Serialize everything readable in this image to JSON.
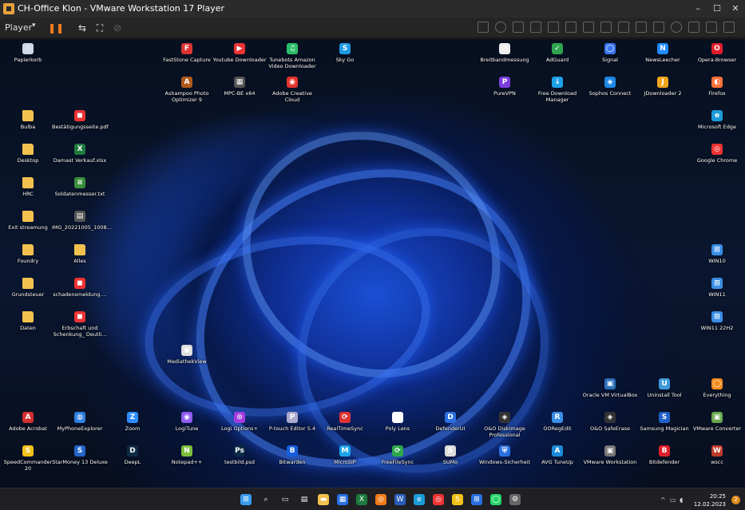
{
  "window": {
    "title": "CH-Office Klon - VMware Workstation 17 Player",
    "minimize": "–",
    "maximize": "☐",
    "close": "✕"
  },
  "toolbar": {
    "player": "Player",
    "caret": "▾",
    "pause": "❚❚",
    "send_keys": "⇆",
    "fullscreen": "⛶",
    "unity": "⊘"
  },
  "colors": {
    "accent": "#f07a1a",
    "folder": "#f2c14e"
  },
  "desktop_icons": [
    {
      "label": "Papierkorb",
      "color": "#cfd8e6",
      "glyph": "♲"
    },
    {
      "label": "FastStone Capture",
      "color": "#d33",
      "glyph": "F"
    },
    {
      "label": "Youtube Downloader",
      "color": "#e33",
      "glyph": "▶"
    },
    {
      "label": "Tunebots Amazon Video Downloader",
      "color": "#2cbf6a",
      "glyph": "♫"
    },
    {
      "label": "Sky Go",
      "color": "#1e9be3",
      "glyph": "S"
    },
    {
      "label": "Breitbandmessung",
      "color": "#eee",
      "glyph": "◔"
    },
    {
      "label": "AdGuard",
      "color": "#2ea44f",
      "glyph": "✓"
    },
    {
      "label": "Signal",
      "color": "#3a76f0",
      "glyph": "◯"
    },
    {
      "label": "NewsLeecher",
      "color": "#1f8bff",
      "glyph": "N"
    },
    {
      "label": "Opera-Browser",
      "color": "#e21e2b",
      "glyph": "O"
    },
    {
      "label": "Ashampoo Photo Optimizer 9",
      "color": "#b05a1a",
      "glyph": "A"
    },
    {
      "label": "MPC-BE x64",
      "color": "#555",
      "glyph": "▦"
    },
    {
      "label": "Adobe Creative Cloud",
      "color": "#e3342f",
      "glyph": "◉"
    },
    {
      "label": "PureVPN",
      "color": "#7a3ddc",
      "glyph": "P"
    },
    {
      "label": "Free Download Manager",
      "color": "#1ca2e8",
      "glyph": "↓"
    },
    {
      "label": "Sophos Connect",
      "color": "#1e88e5",
      "glyph": "◈"
    },
    {
      "label": "JDownloader 2",
      "color": "#f2a51a",
      "glyph": "J"
    },
    {
      "label": "Firefox",
      "color": "#ff7139",
      "glyph": "◐"
    },
    {
      "label": "Bulba",
      "color": "#f2c14e",
      "glyph": ""
    },
    {
      "label": "Bestätigungsseite.pdf",
      "color": "#e33",
      "glyph": "◼"
    },
    {
      "label": "Microsoft Edge",
      "color": "#1c9bd9",
      "glyph": "e"
    },
    {
      "label": "Desktop",
      "color": "#f2c14e",
      "glyph": ""
    },
    {
      "label": "Damast Verkauf.xlsx",
      "color": "#1d7a3e",
      "glyph": "X"
    },
    {
      "label": "Google Chrome",
      "color": "#e33",
      "glyph": "◎"
    },
    {
      "label": "HRC",
      "color": "#f2c14e",
      "glyph": ""
    },
    {
      "label": "Soldatenmesser.txt",
      "color": "#3b8e3b",
      "glyph": "≡"
    },
    {
      "label": "Exit streamung",
      "color": "#f2c14e",
      "glyph": ""
    },
    {
      "label": "IMG_20221005_1008...",
      "color": "#555",
      "glyph": "▤"
    },
    {
      "label": "Foundry",
      "color": "#f2c14e",
      "glyph": ""
    },
    {
      "label": "Alles",
      "color": "#f2c14e",
      "glyph": ""
    },
    {
      "label": "WIN10",
      "color": "#3a8ee6",
      "glyph": "⊞"
    },
    {
      "label": "Grundsteuer",
      "color": "#f2c14e",
      "glyph": ""
    },
    {
      "label": "schadensmeldung....",
      "color": "#e33",
      "glyph": "◼"
    },
    {
      "label": "WIN11",
      "color": "#3a8ee6",
      "glyph": "⊞"
    },
    {
      "label": "Daten",
      "color": "#f2c14e",
      "glyph": ""
    },
    {
      "label": "Erbschaft und Schenkung_ Deutli...",
      "color": "#e33",
      "glyph": "◼"
    },
    {
      "label": "WIN11 22H2",
      "color": "#3a8ee6",
      "glyph": "⊞"
    },
    {
      "label": "MediathekView",
      "color": "#ddd",
      "glyph": "▣"
    },
    {
      "label": "Oracle VM VirtualBox",
      "color": "#2b6fb7",
      "glyph": "▣"
    },
    {
      "label": "Uninstall Tool",
      "color": "#3a9ad9",
      "glyph": "U"
    },
    {
      "label": "Everything",
      "color": "#f28c1a",
      "glyph": "◯"
    },
    {
      "label": "Adobe Acrobat",
      "color": "#d32f2f",
      "glyph": "A"
    },
    {
      "label": "MyPhoneExplorer",
      "color": "#2f7fe0",
      "glyph": "◍"
    },
    {
      "label": "Zoom",
      "color": "#2d8cff",
      "glyph": "Z"
    },
    {
      "label": "LogiTune",
      "color": "#8e5cf0",
      "glyph": "◉"
    },
    {
      "label": "Logi Options+",
      "color": "#a33ce0",
      "glyph": "⊙"
    },
    {
      "label": "P-touch Editor 5.4",
      "color": "#aac",
      "glyph": "P"
    },
    {
      "label": "RealTimeSync",
      "color": "#d33",
      "glyph": "⟳"
    },
    {
      "label": "Poly Lens",
      "color": "#fff",
      "glyph": "◭"
    },
    {
      "label": "DefenderUI",
      "color": "#2a6fe0",
      "glyph": "D"
    },
    {
      "label": "O&O DiskImage Professional",
      "color": "#333",
      "glyph": "◈"
    },
    {
      "label": "OORegEdit",
      "color": "#3a8ee6",
      "glyph": "R"
    },
    {
      "label": "O&O SafeErase",
      "color": "#333",
      "glyph": "◈"
    },
    {
      "label": "Samsung Magician",
      "color": "#1e5fc8",
      "glyph": "S"
    },
    {
      "label": "VMware Converter",
      "color": "#6aa84f",
      "glyph": "▣"
    },
    {
      "label": "SpeedCommander 20",
      "color": "#f2c11a",
      "glyph": "S"
    },
    {
      "label": "StarMoney 13 Deluxe",
      "color": "#2466c8",
      "glyph": "S"
    },
    {
      "label": "DeepL",
      "color": "#0f2b46",
      "glyph": "D"
    },
    {
      "label": "Notepad++",
      "color": "#7bbf3a",
      "glyph": "N"
    },
    {
      "label": "testbild.psd",
      "color": "#0a2a44",
      "glyph": "Ps"
    },
    {
      "label": "Bitwarden",
      "color": "#175ddc",
      "glyph": "B"
    },
    {
      "label": "MicroSIP",
      "color": "#1aa3e8",
      "glyph": "M"
    },
    {
      "label": "FreeFileSync",
      "color": "#2ba84a",
      "glyph": "⟳"
    },
    {
      "label": "SUMo",
      "color": "#ddd",
      "glyph": "S"
    },
    {
      "label": "Windows-Sicherheit",
      "color": "#2a6fe0",
      "glyph": "⛨"
    },
    {
      "label": "AVG TuneUp",
      "color": "#1b8adb",
      "glyph": "A"
    },
    {
      "label": "VMware Workstation",
      "color": "#777",
      "glyph": "▣"
    },
    {
      "label": "Bitdefender",
      "color": "#e01e2b",
      "glyph": "B"
    },
    {
      "label": "wscc",
      "color": "#c0392b",
      "glyph": "W"
    }
  ],
  "taskbar": {
    "items": [
      {
        "name": "windows-start-icon",
        "glyph": "⊞",
        "color": "#3a9bf0"
      },
      {
        "name": "search-icon",
        "glyph": "⌕",
        "color": "transparent"
      },
      {
        "name": "task-view-icon",
        "glyph": "▭",
        "color": "transparent"
      },
      {
        "name": "widgets-icon",
        "glyph": "▤",
        "color": "transparent"
      },
      {
        "name": "file-explorer-icon",
        "glyph": "▬",
        "color": "#f2c14e"
      },
      {
        "name": "store-icon",
        "glyph": "▦",
        "color": "#2a6fe0"
      },
      {
        "name": "excel-icon",
        "glyph": "X",
        "color": "#1d7a3e"
      },
      {
        "name": "avast-icon",
        "glyph": "◎",
        "color": "#f07a1a"
      },
      {
        "name": "word-icon",
        "glyph": "W",
        "color": "#2b5eb8"
      },
      {
        "name": "edge-icon",
        "glyph": "e",
        "color": "#1c9bd9"
      },
      {
        "name": "chrome-icon",
        "glyph": "◎",
        "color": "#e33"
      },
      {
        "name": "sumo-icon",
        "glyph": "S",
        "color": "#f2c11a"
      },
      {
        "name": "windows-icon",
        "glyph": "⊞",
        "color": "#2a6fe0"
      },
      {
        "name": "whatsapp-icon",
        "glyph": "◯",
        "color": "#25d366"
      },
      {
        "name": "settings-icon",
        "glyph": "⚙",
        "color": "#666"
      }
    ]
  },
  "tray": {
    "time": "20:25",
    "date": "12.02.2023",
    "notifications": "2",
    "chevron": "^",
    "network": "▭",
    "volume": "◖"
  }
}
